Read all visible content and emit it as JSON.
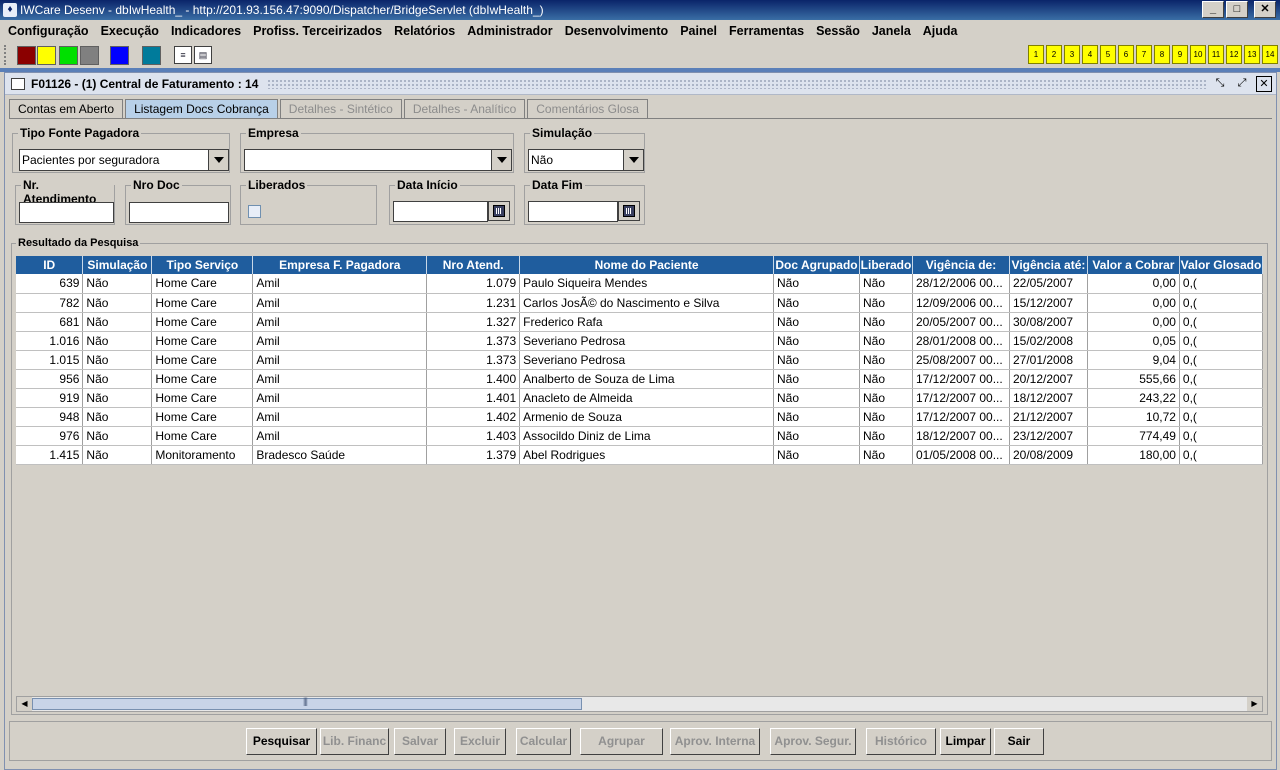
{
  "window": {
    "title": "IWCare Desenv - dbIwHealth_ - http://201.93.156.47:9090/Dispatcher/BridgeServlet (dbIwHealth_)"
  },
  "menu": [
    "Configuração",
    "Execução",
    "Indicadores",
    "Profiss. Terceirizados",
    "Relatórios",
    "Administrador",
    "Desenvolvimento",
    "Painel",
    "Ferramentas",
    "Sessão",
    "Janela",
    "Ajuda"
  ],
  "toolbar": {
    "swatch_colors": [
      "#8b0000",
      "#ffff00",
      "#00e000",
      "#808080",
      "#0000ff",
      "#007b9b"
    ],
    "numbers": [
      "1",
      "2",
      "3",
      "4",
      "5",
      "6",
      "7",
      "8",
      "9",
      "10",
      "11",
      "12",
      "13",
      "14"
    ]
  },
  "frame": {
    "title": "F01126 - (1) Central de Faturamento : 14"
  },
  "tabs": [
    {
      "label": "Contas em Aberto",
      "state": "normal"
    },
    {
      "label": "Listagem Docs Cobrança",
      "state": "active"
    },
    {
      "label": "Detalhes - Sintético",
      "state": "disabled"
    },
    {
      "label": "Detalhes - Analítico",
      "state": "disabled"
    },
    {
      "label": "Comentários Glosa",
      "state": "disabled"
    }
  ],
  "filters": {
    "tipo_fonte": {
      "label": "Tipo Fonte Pagadora",
      "value": "Pacientes por seguradora"
    },
    "empresa": {
      "label": "Empresa",
      "value": ""
    },
    "simulacao": {
      "label": "Simulação",
      "value": "Não"
    },
    "nr_atendimento": {
      "label": "Nr. Atendimento",
      "value": ""
    },
    "nro_doc": {
      "label": "Nro Doc",
      "value": ""
    },
    "liberados": {
      "label": "Liberados",
      "checked": false
    },
    "data_inicio": {
      "label": "Data Início",
      "value": ""
    },
    "data_fim": {
      "label": "Data Fim",
      "value": ""
    }
  },
  "results": {
    "label": "Resultado da Pesquisa",
    "columns": [
      "ID",
      "Simulação",
      "Tipo Serviço",
      "Empresa F. Pagadora",
      "Nro Atend.",
      "Nome do Paciente",
      "Doc Agrupado",
      "Liberado",
      "Vigência de:",
      "Vigência até:",
      "Valor a Cobrar",
      "Valor Glosado"
    ],
    "rows": [
      [
        "639",
        "Não",
        "Home Care",
        "Amil",
        "1.079",
        "Paulo Siqueira Mendes",
        "Não",
        "Não",
        "28/12/2006 00...",
        "22/05/2007",
        "0,00",
        "0,("
      ],
      [
        "782",
        "Não",
        "Home Care",
        "Amil",
        "1.231",
        "Carlos JosÃ© do Nascimento e Silva",
        "Não",
        "Não",
        "12/09/2006 00...",
        "15/12/2007",
        "0,00",
        "0,("
      ],
      [
        "681",
        "Não",
        "Home Care",
        "Amil",
        "1.327",
        "Frederico Rafa",
        "Não",
        "Não",
        "20/05/2007 00...",
        "30/08/2007",
        "0,00",
        "0,("
      ],
      [
        "1.016",
        "Não",
        "Home Care",
        "Amil",
        "1.373",
        "Severiano Pedrosa",
        "Não",
        "Não",
        "28/01/2008 00...",
        "15/02/2008",
        "0,05",
        "0,("
      ],
      [
        "1.015",
        "Não",
        "Home Care",
        "Amil",
        "1.373",
        "Severiano Pedrosa",
        "Não",
        "Não",
        "25/08/2007 00...",
        "27/01/2008",
        "9,04",
        "0,("
      ],
      [
        "956",
        "Não",
        "Home Care",
        "Amil",
        "1.400",
        "Analberto de Souza de Lima",
        "Não",
        "Não",
        "17/12/2007 00...",
        "20/12/2007",
        "555,66",
        "0,("
      ],
      [
        "919",
        "Não",
        "Home Care",
        "Amil",
        "1.401",
        "Anacleto de Almeida",
        "Não",
        "Não",
        "17/12/2007 00...",
        "18/12/2007",
        "243,22",
        "0,("
      ],
      [
        "948",
        "Não",
        "Home Care",
        "Amil",
        "1.402",
        "Armenio de Souza",
        "Não",
        "Não",
        "17/12/2007 00...",
        "21/12/2007",
        "10,72",
        "0,("
      ],
      [
        "976",
        "Não",
        "Home Care",
        "Amil",
        "1.403",
        "Associldo Diniz de Lima",
        "Não",
        "Não",
        "18/12/2007 00...",
        "23/12/2007",
        "774,49",
        "0,("
      ],
      [
        "1.415",
        "Não",
        "Monitoramento",
        "Bradesco Saúde",
        "1.379",
        "Abel Rodrigues",
        "Não",
        "Não",
        "01/05/2008 00...",
        "20/08/2009",
        "180,00",
        "0,("
      ]
    ]
  },
  "buttons": [
    {
      "label": "Pesquisar",
      "enabled": true
    },
    {
      "label": "Lib. Financ",
      "enabled": false
    },
    {
      "label": "Salvar",
      "enabled": false
    },
    {
      "label": "Excluir",
      "enabled": false
    },
    {
      "label": "Calcular",
      "enabled": false
    },
    {
      "label": "Agrupar",
      "enabled": false
    },
    {
      "label": "Aprov. Interna",
      "enabled": false
    },
    {
      "label": "Aprov. Segur.",
      "enabled": false
    },
    {
      "label": "Histórico",
      "enabled": false
    },
    {
      "label": "Limpar",
      "enabled": true
    },
    {
      "label": "Sair",
      "enabled": true
    }
  ]
}
